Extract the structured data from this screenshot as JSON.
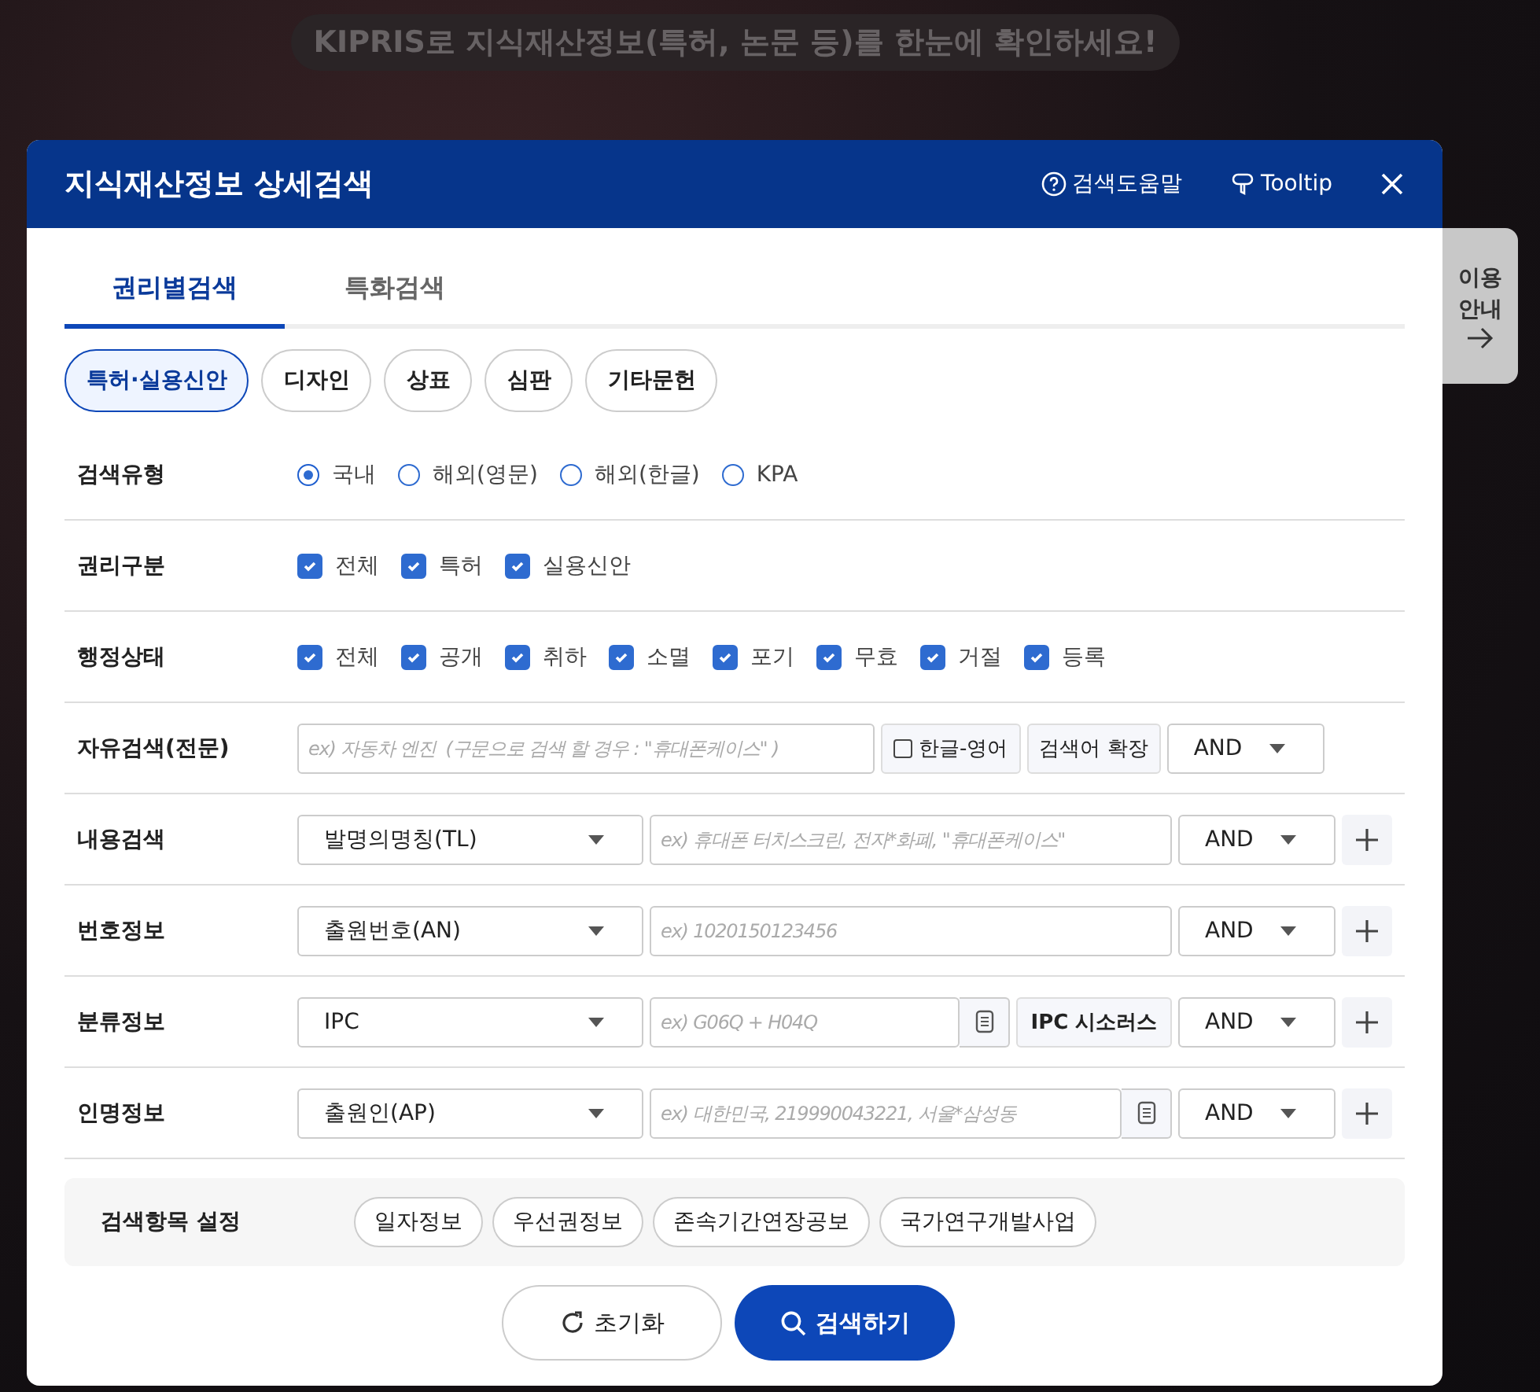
{
  "banner": "KIPRIS로 지식재산정보(특허, 논문 등)를 한눈에 확인하세요!",
  "side_tab": {
    "lines": [
      "이용",
      "안내"
    ]
  },
  "dialog": {
    "title": "지식재산정보 상세검색",
    "help": "검색도움말",
    "tooltip": "Tooltip"
  },
  "tabs": [
    {
      "label": "권리별검색",
      "selected": true
    },
    {
      "label": "특화검색",
      "selected": false
    }
  ],
  "chips": [
    {
      "label": "특허·실용신안",
      "selected": true
    },
    {
      "label": "디자인",
      "selected": false
    },
    {
      "label": "상표",
      "selected": false
    },
    {
      "label": "심판",
      "selected": false
    },
    {
      "label": "기타문헌",
      "selected": false
    }
  ],
  "rows": [
    {
      "kind": "radio",
      "label": "검색유형",
      "options": [
        {
          "label": "국내",
          "selected": true
        },
        {
          "label": "해외(영문)",
          "selected": false
        },
        {
          "label": "해외(한글)",
          "selected": false
        },
        {
          "label": "KPA",
          "selected": false
        }
      ]
    },
    {
      "kind": "checkbox",
      "label": "권리구분",
      "options": [
        {
          "label": "전체",
          "checked": true
        },
        {
          "label": "특허",
          "checked": true
        },
        {
          "label": "실용신안",
          "checked": true
        }
      ]
    },
    {
      "kind": "checkbox",
      "label": "행정상태",
      "options": [
        {
          "label": "전체",
          "checked": true
        },
        {
          "label": "공개",
          "checked": true
        },
        {
          "label": "취하",
          "checked": true
        },
        {
          "label": "소멸",
          "checked": true
        },
        {
          "label": "포기",
          "checked": true
        },
        {
          "label": "무효",
          "checked": true
        },
        {
          "label": "거절",
          "checked": true
        },
        {
          "label": "등록",
          "checked": true
        }
      ]
    },
    {
      "kind": "free",
      "label": "자유검색(전문)",
      "placeholder": "ex) 자동차 엔진  (구문으로 검색 할 경우 : \"휴대폰케이스\" )",
      "toggle": {
        "label": "한글-영어",
        "checked": false
      },
      "button": "검색어 확장",
      "operator": "AND"
    },
    {
      "kind": "field",
      "label": "내용검색",
      "select": "발명의명칭(TL)",
      "placeholder": "ex) 휴대폰 터치스크린, 전자*화폐, \"휴대폰케이스\"",
      "operator": "AND"
    },
    {
      "kind": "field",
      "label": "번호정보",
      "select": "출원번호(AN)",
      "placeholder": "ex) 1020150123456",
      "operator": "AND"
    },
    {
      "kind": "field",
      "label": "분류정보",
      "select": "IPC",
      "placeholder": "ex) G06Q + H04Q",
      "doc": true,
      "button": "IPC 시소러스",
      "operator": "AND"
    },
    {
      "kind": "field",
      "label": "인명정보",
      "select": "출원인(AP)",
      "placeholder": "ex) 대한민국, 219990043221, 서울*삼성동",
      "doc": true,
      "operator": "AND"
    }
  ],
  "settings": {
    "label": "검색항목 설정",
    "items": [
      "일자정보",
      "우선권정보",
      "존속기간연장공보",
      "국가연구개발사업"
    ]
  },
  "actions": {
    "reset": "초기화",
    "search": "검색하기"
  }
}
